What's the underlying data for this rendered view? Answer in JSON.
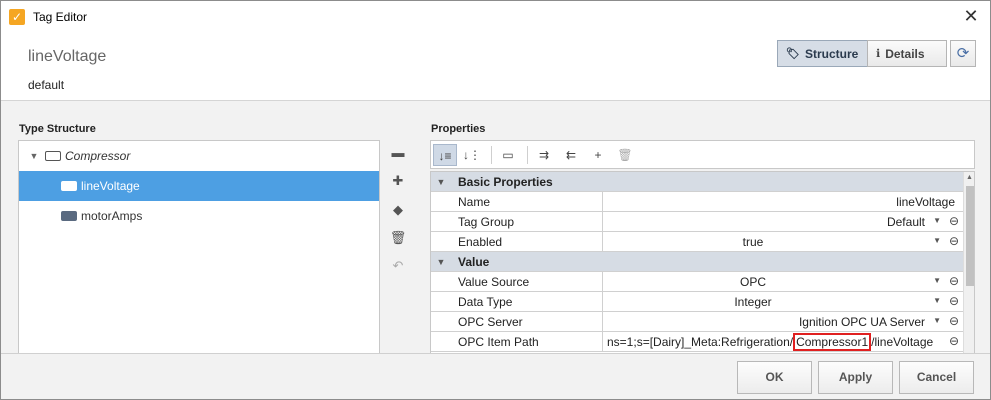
{
  "window": {
    "title": "Tag Editor",
    "app_icon": "ignition-icon"
  },
  "header": {
    "tag_name": "lineVoltage",
    "tag_provider": "default",
    "view_tabs": [
      {
        "label": "Structure",
        "icon": "tag-icon",
        "active": true
      },
      {
        "label": "Details",
        "icon": "info-icon",
        "active": false
      }
    ]
  },
  "type_structure": {
    "label": "Type Structure",
    "items": [
      {
        "label": "Compressor",
        "icon": "udt-icon",
        "expanded": true,
        "italic": true
      },
      {
        "label": "lineVoltage",
        "icon": "tag-icon",
        "selected": true
      },
      {
        "label": "motorAmps",
        "icon": "tag-icon"
      }
    ]
  },
  "properties": {
    "label": "Properties",
    "categories": [
      {
        "name": "Basic Properties",
        "rows": [
          {
            "name": "Name",
            "value": "lineVoltage"
          },
          {
            "name": "Tag Group",
            "value": "Default"
          },
          {
            "name": "Enabled",
            "value": "true"
          }
        ]
      },
      {
        "name": "Value",
        "rows": [
          {
            "name": "Value Source",
            "value": "OPC"
          },
          {
            "name": "Data Type",
            "value": "Integer"
          },
          {
            "name": "OPC Server",
            "value": "Ignition OPC UA Server"
          },
          {
            "name": "OPC Item Path",
            "value_prefix": "ns=1;s=[Dairy]_Meta:Refrigeration/",
            "value_highlight": "Compressor1",
            "value_suffix": "/lineVoltage"
          }
        ]
      }
    ]
  },
  "footer": {
    "ok": "OK",
    "apply": "Apply",
    "cancel": "Cancel"
  },
  "colors": {
    "selection": "#4d9fe3",
    "highlight_box": "#e02020",
    "category_bg": "#d6dce4"
  }
}
